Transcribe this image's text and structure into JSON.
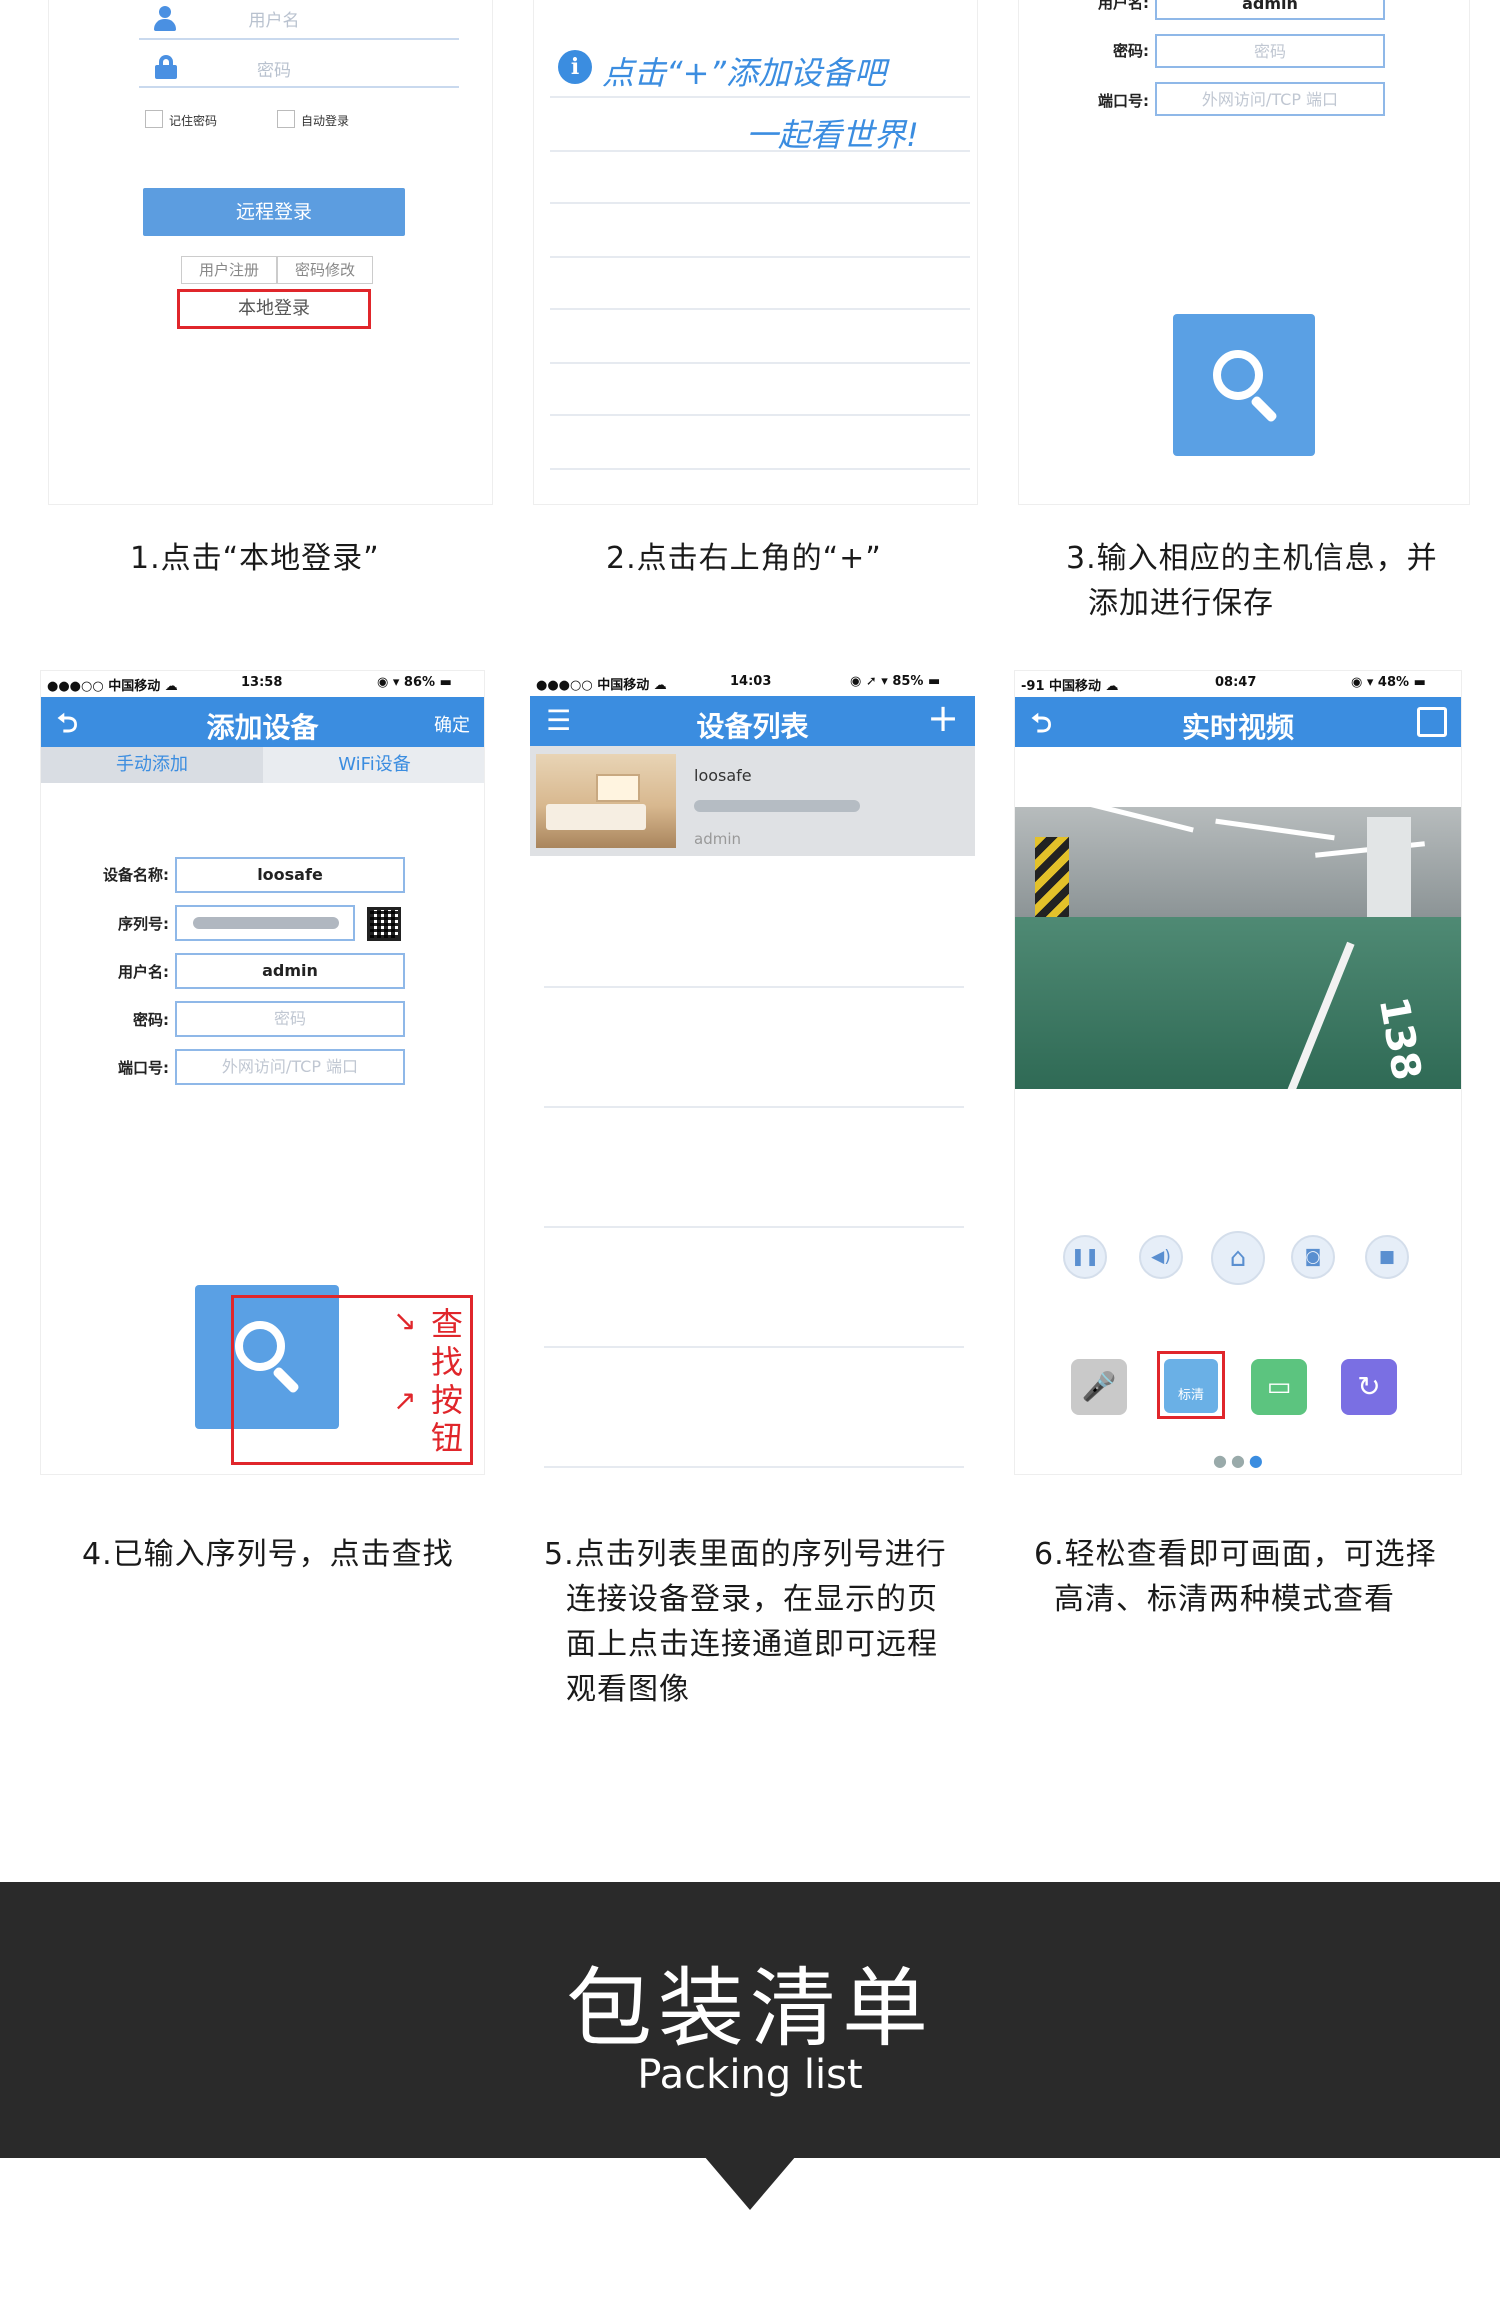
{
  "panel1": {
    "username_placeholder": "用户名",
    "password_placeholder": "密码",
    "remember_label": "记住密码",
    "auto_login_label": "自动登录",
    "remote_login": "远程登录",
    "register": "用户注册",
    "change_password": "密码修改",
    "local_login": "本地登录",
    "caption": "1.点击“本地登录”"
  },
  "panel2": {
    "hint_line1": "点击“+”添加设备吧",
    "hint_line2": "一起看世界!",
    "caption": "2.点击右上角的“+”"
  },
  "panel3": {
    "username_label": "用户名:",
    "username_value": "admin",
    "password_label": "密码:",
    "password_placeholder": "密码",
    "port_label": "端口号:",
    "port_placeholder": "外网访问/TCP 端口",
    "caption_line1": "3.输入相应的主机信息，并",
    "caption_line2": "添加进行保存"
  },
  "panel4": {
    "status_left": "●●●○○ 中国移动 ☁",
    "status_time": "13:58",
    "status_right": "◉ ▾ 86% ▬",
    "title": "添加设备",
    "confirm": "确定",
    "tab_manual": "手动添加",
    "tab_wifi": "WiFi设备",
    "device_name_label": "设备名称:",
    "device_name_value": "loosafe",
    "serial_label": "序列号:",
    "username_label": "用户名:",
    "username_value": "admin",
    "password_label": "密码:",
    "password_placeholder": "密码",
    "port_label": "端口号:",
    "port_placeholder": "外网访问/TCP 端口",
    "annotation": [
      "查",
      "找",
      "按",
      "钮"
    ],
    "caption": "4.已输入序列号，点击查找"
  },
  "panel5": {
    "status_left": "●●●○○ 中国移动 ☁",
    "status_time": "14:03",
    "status_right": "◉ ➚ ▾ 85% ▬",
    "title": "设备列表",
    "device_name": "loosafe",
    "device_user": "admin",
    "caption_lines": [
      "5.点击列表里面的序列号进行",
      "连接设备登录，在显示的页",
      "面上点击连接通道即可远程",
      "观看图像"
    ]
  },
  "panel6": {
    "status_left": "-91 中国移动 ☁",
    "status_time": "08:47",
    "status_right": "◉ ▾ 48% ▬",
    "title": "实时视频",
    "mode_label": "标清",
    "caption_line1": "6.轻松查看即可画面，可选择",
    "caption_line2": "高清、标清两种模式查看"
  },
  "banner": {
    "title": "包装清单",
    "subtitle": "Packing list"
  },
  "colors": {
    "accent": "#3b8de0",
    "banner_bg": "#2a2a2a",
    "highlight_red": "#e0262b"
  }
}
